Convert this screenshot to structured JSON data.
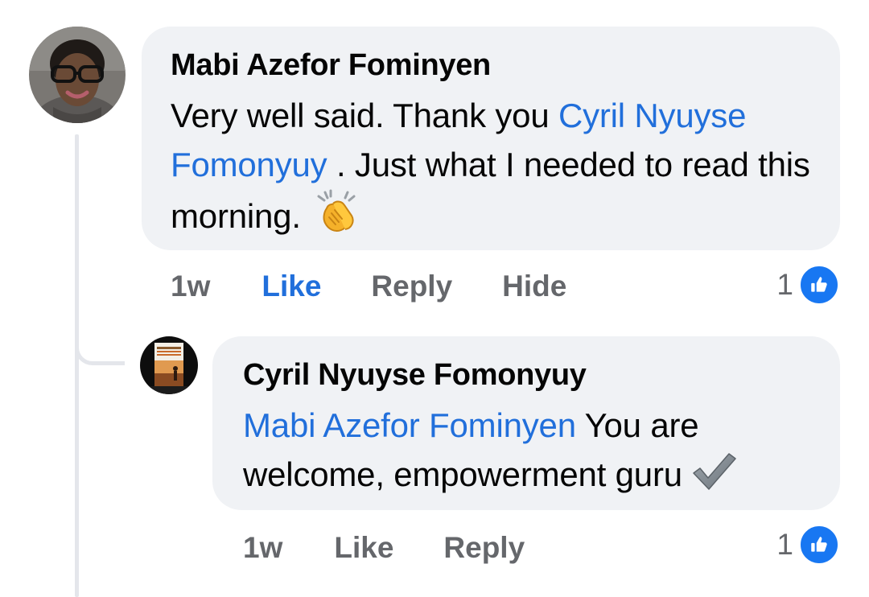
{
  "comment": {
    "author": "Mabi Azefor Fominyen",
    "text_before": "Very well said. Thank you ",
    "mention": "Cyril Nyuyse Fomonyuy",
    "text_after": " . Just what I needed to read this morning.",
    "emoji": "clapping-hands",
    "timestamp": "1w",
    "like_label": "Like",
    "reply_label": "Reply",
    "hide_label": "Hide",
    "reaction_count": "1",
    "liked": true
  },
  "reply": {
    "author": "Cyril Nyuyse Fomonyuy",
    "mention": "Mabi Azefor Fominyen",
    "text_after": " You are welcome, empowerment guru",
    "emoji": "check-mark",
    "timestamp": "1w",
    "like_label": "Like",
    "reply_label": "Reply",
    "reaction_count": "1"
  },
  "colors": {
    "bubble": "#f0f2f5",
    "mention": "#216fdb",
    "secondary_text": "#65676b",
    "like_blue": "#1877f2",
    "thread_line": "#e4e6eb"
  }
}
